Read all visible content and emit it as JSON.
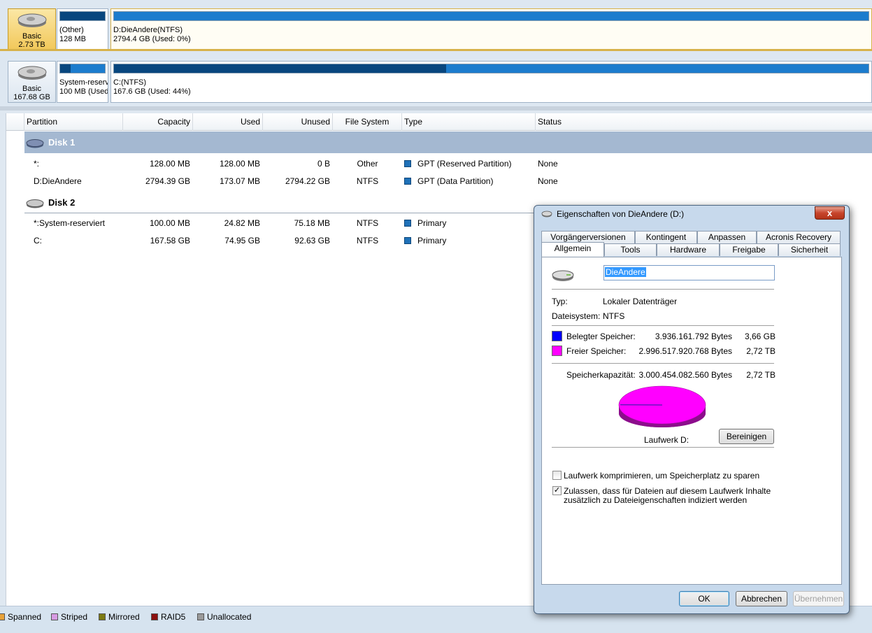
{
  "disk_map": {
    "disk1": {
      "card_type": "Basic",
      "card_size": "2.73 TB",
      "partitions": [
        {
          "label": "(Other)",
          "size": "128 MB",
          "used_fraction": 1.0
        },
        {
          "label": "D:DieAndere(NTFS)",
          "size": "2794.4 GB (Used: 0%)",
          "used_fraction": 0.0
        }
      ]
    },
    "disk2": {
      "card_type": "Basic",
      "card_size": "167.68 GB",
      "partitions": [
        {
          "label": "System-reserv",
          "size": "100 MB (Used:",
          "used_fraction": 0.24
        },
        {
          "label": "C:(NTFS)",
          "size": "167.6 GB (Used: 44%)",
          "used_fraction": 0.44
        }
      ]
    }
  },
  "table": {
    "headers": [
      "Partition",
      "Capacity",
      "Used",
      "Unused",
      "File System",
      "Type",
      "Status"
    ],
    "disk1_label": "Disk 1",
    "disk2_label": "Disk 2",
    "disk1_rows": [
      {
        "partition": "*:",
        "capacity": "128.00 MB",
        "used": "128.00 MB",
        "unused": "0 B",
        "fs": "Other",
        "type": "GPT (Reserved Partition)",
        "status": "None"
      },
      {
        "partition": "D:DieAndere",
        "capacity": "2794.39 GB",
        "used": "173.07 MB",
        "unused": "2794.22 GB",
        "fs": "NTFS",
        "type": "GPT (Data Partition)",
        "status": "None"
      }
    ],
    "disk2_rows": [
      {
        "partition": "*:System-reserviert",
        "capacity": "100.00 MB",
        "used": "24.82 MB",
        "unused": "75.18 MB",
        "fs": "NTFS",
        "type": "Primary"
      },
      {
        "partition": "C:",
        "capacity": "167.58 GB",
        "used": "74.95 GB",
        "unused": "92.63 GB",
        "fs": "NTFS",
        "type": "Primary"
      }
    ]
  },
  "legend": [
    {
      "label": "Spanned",
      "color": "#e8a23a"
    },
    {
      "label": "Striped",
      "color": "#d79be3"
    },
    {
      "label": "Mirrored",
      "color": "#7c7a12"
    },
    {
      "label": "RAID5",
      "color": "#8b1010"
    },
    {
      "label": "Unallocated",
      "color": "#9a9a9a"
    }
  ],
  "dialog": {
    "title": "Eigenschaften von DieAndere (D:)",
    "close_glyph": "x",
    "tabs_row1": [
      "Vorgängerversionen",
      "Kontingent",
      "Anpassen",
      "Acronis Recovery"
    ],
    "tabs_row2": [
      "Allgemein",
      "Tools",
      "Hardware",
      "Freigabe",
      "Sicherheit"
    ],
    "name_value": "DieAndere",
    "typ_label": "Typ:",
    "typ_value": "Lokaler Datenträger",
    "fs_label": "Dateisystem:",
    "fs_value": "NTFS",
    "used_label": "Belegter Speicher:",
    "used_bytes": "3.936.161.792 Bytes",
    "used_short": "3,66 GB",
    "used_color": "#0000ff",
    "free_label": "Freier Speicher:",
    "free_bytes": "2.996.517.920.768 Bytes",
    "free_short": "2,72 TB",
    "free_color": "#ff00ff",
    "cap_label": "Speicherkapazität:",
    "cap_bytes": "3.000.454.082.560 Bytes",
    "cap_short": "2,72 TB",
    "drive_label": "Laufwerk D:",
    "used_fraction": 0.0013,
    "cleanup_button": "Bereinigen",
    "compress_label": "Laufwerk komprimieren, um Speicherplatz zu sparen",
    "compress_checked": false,
    "index_label_line1": "Zulassen, dass für Dateien auf diesem Laufwerk Inhalte",
    "index_label_line2": "zusätzlich zu Dateieigenschaften indiziert werden",
    "index_checked": true,
    "check_glyph": "✓",
    "ok_button": "OK",
    "cancel_button": "Abbrechen",
    "apply_button": "Übernehmen"
  }
}
